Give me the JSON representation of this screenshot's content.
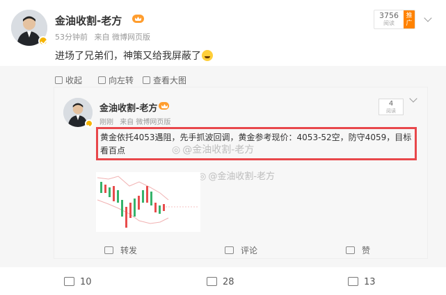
{
  "post": {
    "author": "金油收割-老方",
    "time": "53分钟前",
    "source": "来自 微博网页版",
    "text": "进场了兄弟们，神策又给我屏蔽了",
    "read_count": "3756",
    "read_label": "阅读",
    "promote_label": "推广"
  },
  "toolbar": {
    "collapse": "收起",
    "rotate": "向左转",
    "view_large": "查看大图"
  },
  "repost": {
    "author": "金油收割-老方",
    "time": "刚刚",
    "source": "来自 微博网页版",
    "text": "黄金依托4053遇阻，先手抓波回调，黄金参考现价：4053-52空，防守4059，目标看百点",
    "read_count": "4",
    "read_label": "阅读",
    "watermark": "@金油收割-老方",
    "actions": {
      "share": "转发",
      "comment": "评论",
      "like": "赞"
    }
  },
  "footer": {
    "share_count": "10",
    "comment_count": "28",
    "like_count": "13"
  },
  "colors": {
    "accent_orange": "#ff8200",
    "highlight_red": "#e8474b",
    "verified_gold": "#f6b400",
    "candle_up": "#e84c4c",
    "candle_down": "#36b36b"
  }
}
